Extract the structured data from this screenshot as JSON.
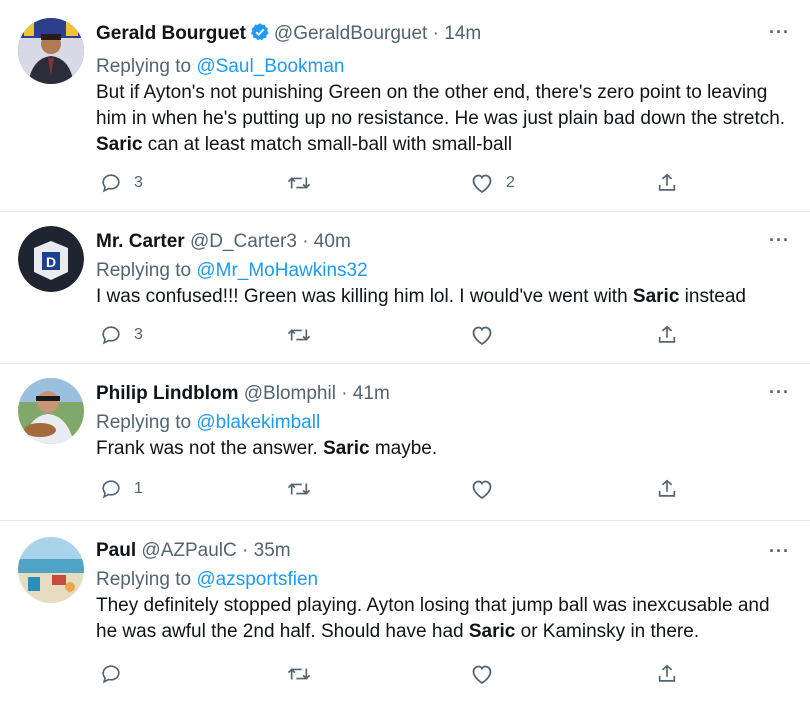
{
  "tweets": [
    {
      "name": "Gerald Bourguet",
      "verified": true,
      "handle": "@GeraldBourguet",
      "time": "· 14m",
      "replying_prefix": "Replying to ",
      "replying_to": "@Saul_Bookman",
      "text_parts": [
        "But if Ayton's not punishing Green on the other end, there's zero point to leaving him in when he's putting up no resistance. He was just plain bad down the stretch. ",
        "Saric",
        " can at least match small-ball with small-ball"
      ],
      "replies": "3",
      "retweets": "",
      "likes": "2"
    },
    {
      "name": "Mr. Carter",
      "verified": false,
      "handle": "@D_Carter3",
      "time": "· 40m",
      "replying_prefix": "Replying to ",
      "replying_to": "@Mr_MoHawkins32",
      "text_parts": [
        "I was confused!!! Green was killing him lol. I would've went with ",
        "Saric",
        " instead"
      ],
      "replies": "3",
      "retweets": "",
      "likes": ""
    },
    {
      "name": "Philip Lindblom",
      "verified": false,
      "handle": "@Blomphil",
      "time": "· 41m",
      "replying_prefix": "Replying to ",
      "replying_to": "@blakekimball",
      "text_parts": [
        "Frank was not the answer. ",
        "Saric",
        " maybe."
      ],
      "replies": "1",
      "retweets": "",
      "likes": ""
    },
    {
      "name": "Paul",
      "verified": false,
      "handle": "@AZPaulC",
      "time": "· 35m",
      "replying_prefix": "Replying to ",
      "replying_to": "@azsportsfien",
      "text_parts": [
        "They definitely stopped playing. Ayton losing that jump ball was inexcusable and he was awful the 2nd half. Should have had ",
        "Saric",
        " or Kaminsky in there."
      ],
      "replies": "",
      "retweets": "",
      "likes": ""
    }
  ],
  "more_label": "···",
  "icons": {
    "reply": "reply-icon",
    "retweet": "retweet-icon",
    "like": "like-icon",
    "share": "share-icon",
    "verified": "verified-badge-icon",
    "more": "more-options-icon"
  },
  "colors": {
    "accent": "#1d9bf0",
    "secondary_text": "#536471",
    "primary_text": "#0f1419",
    "divider": "#e6e9ec"
  }
}
